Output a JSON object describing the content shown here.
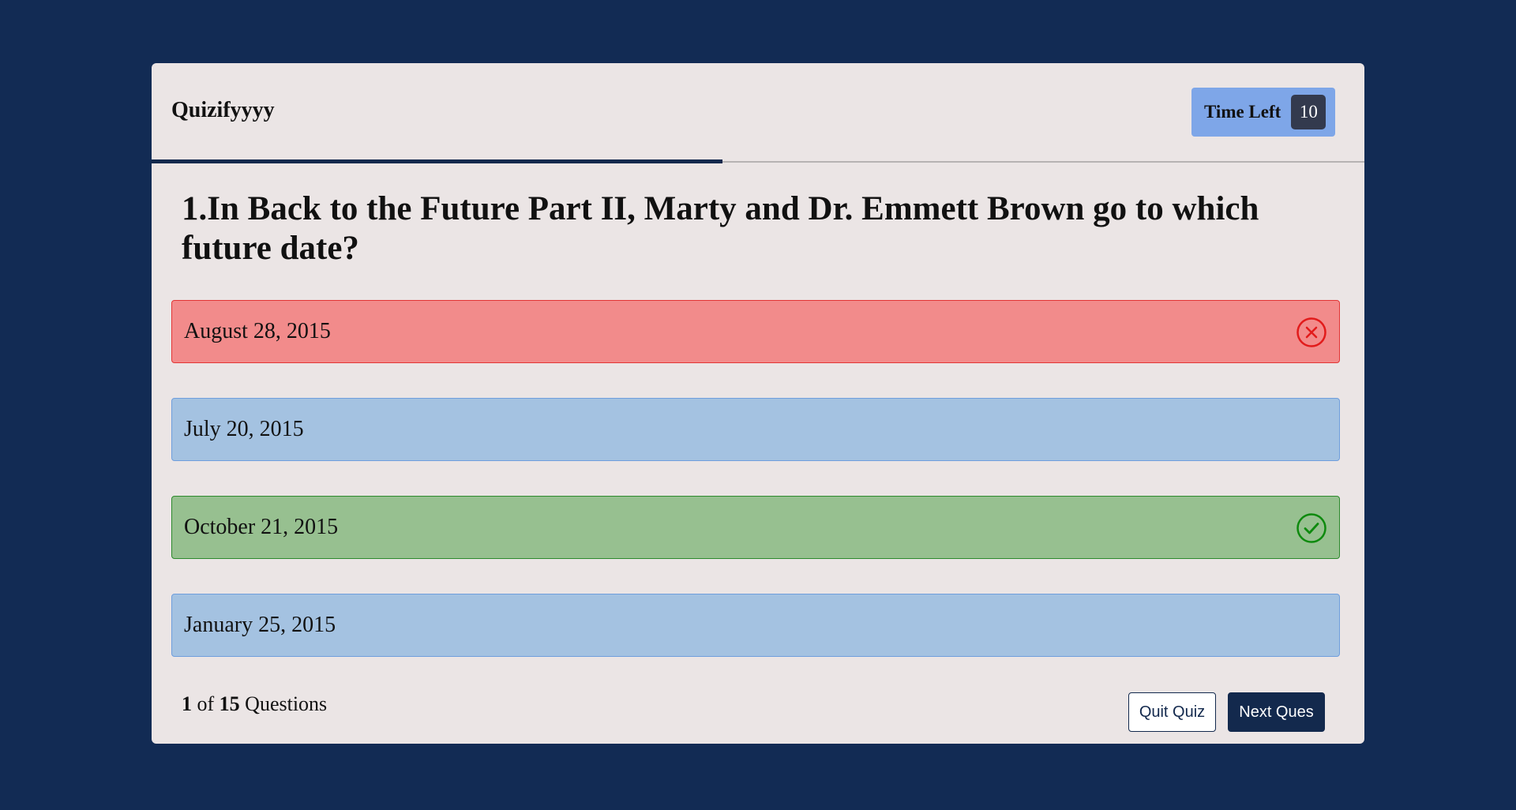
{
  "app": {
    "title": "Quizifyyyy"
  },
  "timer": {
    "label": "Time Left",
    "value": "10"
  },
  "progress": {
    "fraction": 0.471
  },
  "question": {
    "text": "1.In Back to the Future Part II, Marty and Dr. Emmett Brown go to which future date?"
  },
  "options": [
    {
      "label": "August 28, 2015",
      "status": "wrong",
      "icon": "x-circle-icon"
    },
    {
      "label": "July 20, 2015",
      "status": "neutral",
      "icon": ""
    },
    {
      "label": "October 21, 2015",
      "status": "correct",
      "icon": "check-circle-icon"
    },
    {
      "label": "January 25, 2015",
      "status": "neutral",
      "icon": ""
    }
  ],
  "footer": {
    "current": "1",
    "of_text": "of",
    "total": "15",
    "questions_text": "Questions",
    "quit_label": "Quit Quiz",
    "next_label": "Next Ques"
  },
  "colors": {
    "background": "#122b54",
    "card": "#ebe5e5",
    "wrong": "#f28b8b",
    "correct": "#97c090",
    "neutral": "#a4c2e1",
    "accent": "#13294d",
    "timer": "#7ea6e8"
  }
}
